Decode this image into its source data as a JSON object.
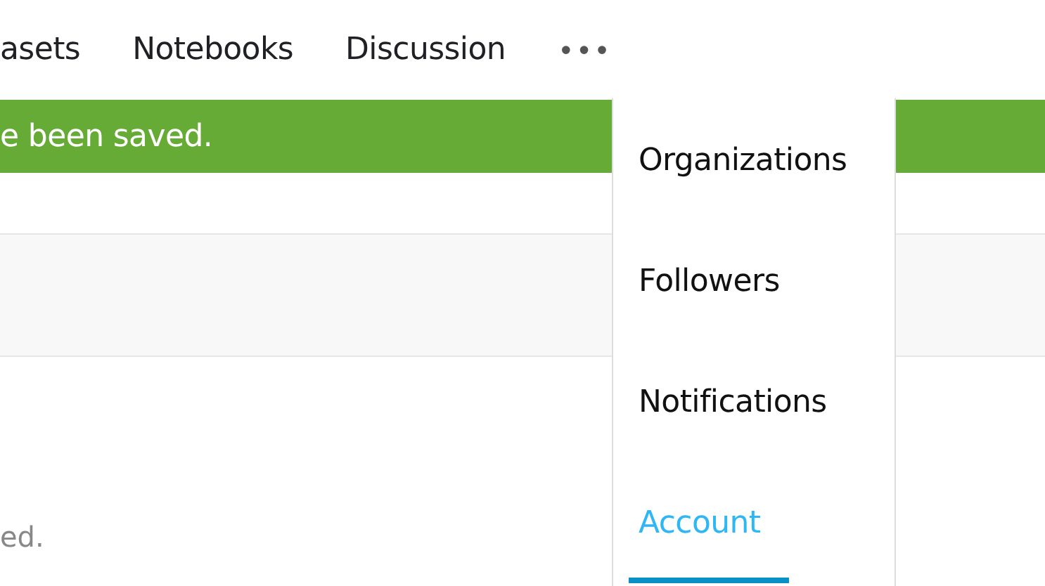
{
  "nav": {
    "tabs": [
      {
        "label": "asets"
      },
      {
        "label": "Notebooks"
      },
      {
        "label": "Discussion"
      }
    ],
    "more": "•••"
  },
  "banner": {
    "message": "e been saved."
  },
  "footer_text": "ed.",
  "menu": {
    "items": [
      {
        "label": "Organizations",
        "selected": false
      },
      {
        "label": "Followers",
        "selected": false
      },
      {
        "label": "Notifications",
        "selected": false
      },
      {
        "label": "Account",
        "selected": true
      }
    ]
  }
}
